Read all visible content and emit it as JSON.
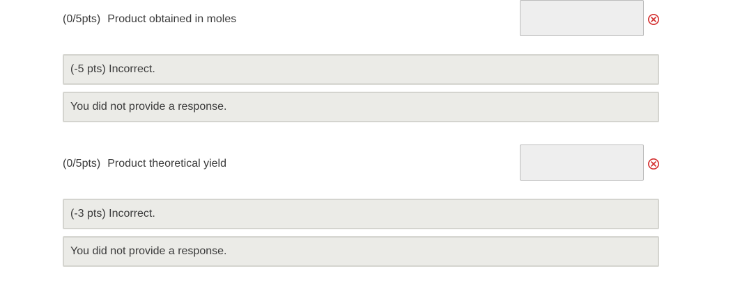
{
  "questions": [
    {
      "score": "(0/5pts)",
      "prompt": "Product obtained in moles",
      "input_value": "",
      "status_icon": "incorrect-x-icon",
      "penalty_feedback": "(-5 pts) Incorrect.",
      "response_feedback": "You did not provide a response."
    },
    {
      "score": "(0/5pts)",
      "prompt": "Product theoretical yield",
      "input_value": "",
      "status_icon": "incorrect-x-icon",
      "penalty_feedback": "(-3 pts) Incorrect.",
      "response_feedback": "You did not provide a response."
    }
  ],
  "colors": {
    "error_red": "#d32f2f",
    "feedback_bg": "#ebebe7",
    "feedback_border": "#d4d4cf",
    "input_bg": "#eeeeee"
  }
}
